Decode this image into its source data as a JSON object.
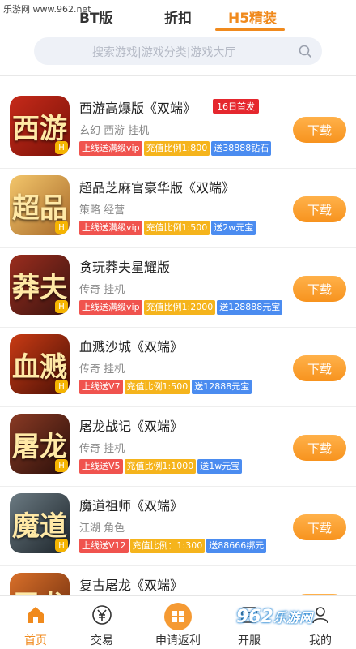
{
  "watermark": "乐游网 www.962.net",
  "tabs": [
    {
      "label": "BT版"
    },
    {
      "label": "折扣"
    },
    {
      "label": "H5精装"
    }
  ],
  "search": {
    "placeholder": "搜索游戏|游戏分类|游戏大厅"
  },
  "games": [
    {
      "title": "西游高爆版《双端》",
      "badge": "16日首发",
      "sub": "玄幻 西游 挂机",
      "icon_text": "西游",
      "tags": [
        {
          "text": "上线送满级vip",
          "color": "red"
        },
        {
          "text": "充值比例1:800",
          "color": "yel"
        },
        {
          "text": "送38888钻石",
          "color": "blu"
        }
      ],
      "button": "下载"
    },
    {
      "title": "超品芝麻官豪华版《双端》",
      "badge": "",
      "sub": "策略 经营",
      "icon_text": "超品",
      "tags": [
        {
          "text": "上线送满级vip",
          "color": "red"
        },
        {
          "text": "充值比例1:500",
          "color": "yel"
        },
        {
          "text": "送2w元宝",
          "color": "blu"
        }
      ],
      "button": "下载"
    },
    {
      "title": "贪玩莽夫星耀版",
      "badge": "",
      "sub": "传奇 挂机",
      "icon_text": "莽夫",
      "tags": [
        {
          "text": "上线送满级vip",
          "color": "red"
        },
        {
          "text": "充值比例1:2000",
          "color": "yel"
        },
        {
          "text": "送128888元宝",
          "color": "blu"
        }
      ],
      "button": "下载"
    },
    {
      "title": "血溅沙城《双端》",
      "badge": "",
      "sub": "传奇 挂机",
      "icon_text": "血溅",
      "tags": [
        {
          "text": "上线送V7",
          "color": "red"
        },
        {
          "text": "充值比例1:500",
          "color": "yel"
        },
        {
          "text": "送12888元宝",
          "color": "blu"
        }
      ],
      "button": "下载"
    },
    {
      "title": "屠龙战记《双端》",
      "badge": "",
      "sub": "传奇 挂机",
      "icon_text": "屠龙",
      "tags": [
        {
          "text": "上线送V5",
          "color": "red"
        },
        {
          "text": "充值比例1:1000",
          "color": "yel"
        },
        {
          "text": "送1w元宝",
          "color": "blu"
        }
      ],
      "button": "下载"
    },
    {
      "title": "魔道祖师《双端》",
      "badge": "",
      "sub": "江湖 角色",
      "icon_text": "魔道",
      "tags": [
        {
          "text": "上线送V12",
          "color": "red"
        },
        {
          "text": "充值比例：1:300",
          "color": "yel"
        },
        {
          "text": "送88666绑元",
          "color": "blu"
        }
      ],
      "button": "下载"
    },
    {
      "title": "复古屠龙《双端》",
      "badge": "",
      "sub": "",
      "icon_text": "屠龙",
      "tags": [],
      "button": "下载"
    }
  ],
  "bottom_nav": [
    {
      "label": "首页"
    },
    {
      "label": "交易"
    },
    {
      "label": "申请返利"
    },
    {
      "label": "开服"
    },
    {
      "label": "我的"
    }
  ],
  "brand": "962",
  "brand_sub": "乐游网",
  "colors": {
    "accent": "#f08a1d",
    "red_tag": "#f0534e",
    "yellow_tag": "#f5b41c",
    "blue_tag": "#4b8cf0"
  }
}
